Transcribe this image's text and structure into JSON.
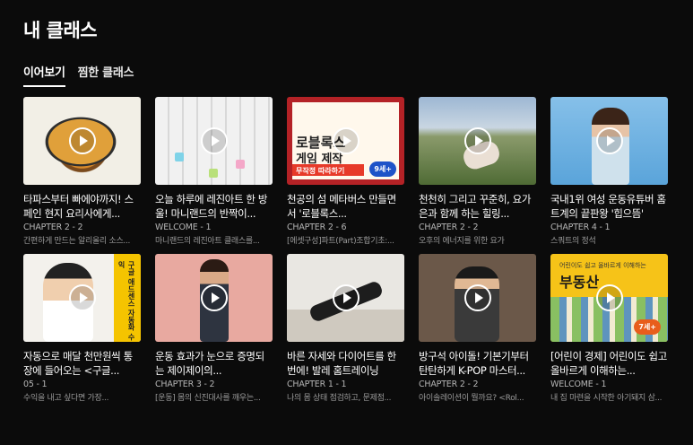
{
  "page": {
    "title": "내 클래스"
  },
  "tabs": [
    {
      "label": "이어보기",
      "active": true
    },
    {
      "label": "찜한 클래스",
      "active": false
    }
  ],
  "cards": [
    {
      "title": "타파스부터 빠에야까지! 스페인 현지 요리사에게...",
      "chapter": "CHAPTER 2 - 2",
      "desc": "간편하게 만드는 알리올리 소스..."
    },
    {
      "title": "오늘 하루에 레진아트 한 방울! 마니랜드의 반짝이...",
      "chapter": "WELCOME - 1",
      "desc": "마니랜드의 레진아트 클래스를..."
    },
    {
      "title": "천공의 섬 메타버스 만들면서 '로블록스...",
      "chapter": "CHAPTER 2 - 6",
      "desc": "[에셋구성]파트(Part)조합기초:..."
    },
    {
      "title": "천천히 그리고 꾸준히, 요가은과 함께 하는 힐링...",
      "chapter": "CHAPTER 2 - 2",
      "desc": "오후의 에너지를 위한 요가"
    },
    {
      "title": "국내1위 여성 운동유튜버 홈트계의 끝판왕 '힙으뜸'",
      "chapter": "CHAPTER 4 - 1",
      "desc": "스쿼트의 정석"
    },
    {
      "title": "자동으로 매달 천만원씩 통장에 들어오는 <구글...",
      "chapter": "05 - 1",
      "desc": "수익을 내고 싶다면 가장..."
    },
    {
      "title": "운동 효과가 눈으로 증명되는 제이제이의...",
      "chapter": "CHAPTER 3 - 2",
      "desc": "[운동] 몸의 신진대사를 깨우는..."
    },
    {
      "title": "바른 자세와 다이어트를 한번에! 발레 홈트레이닝",
      "chapter": "CHAPTER 1 - 1",
      "desc": "나의 몸 상태 점검하고, 문제점..."
    },
    {
      "title": "방구석 아이돌! 기본기부터 탄탄하게 K-POP 마스터...",
      "chapter": "CHAPTER 2 - 2",
      "desc": "아이솔레이션이 뭘까요? <Rol..."
    },
    {
      "title": "[어린이 경제] 어린이도 쉽고 올바르게 이해하는...",
      "chapter": "WELCOME - 1",
      "desc": "내 집 마련을 시작한 아기돼지 삼..."
    }
  ],
  "thumbs": {
    "roblox_line1": "로블록스",
    "roblox_line2": "게임 제작",
    "roblox_bar": "무작정 따라하기",
    "roblox_badge": "9세+",
    "google_side": "구글 애드센스 자동화 수익",
    "realestate_sub": "어린이도 쉽고 올바르게 이해하는",
    "realestate_big": "부동산",
    "realestate_badge": "7세+"
  }
}
